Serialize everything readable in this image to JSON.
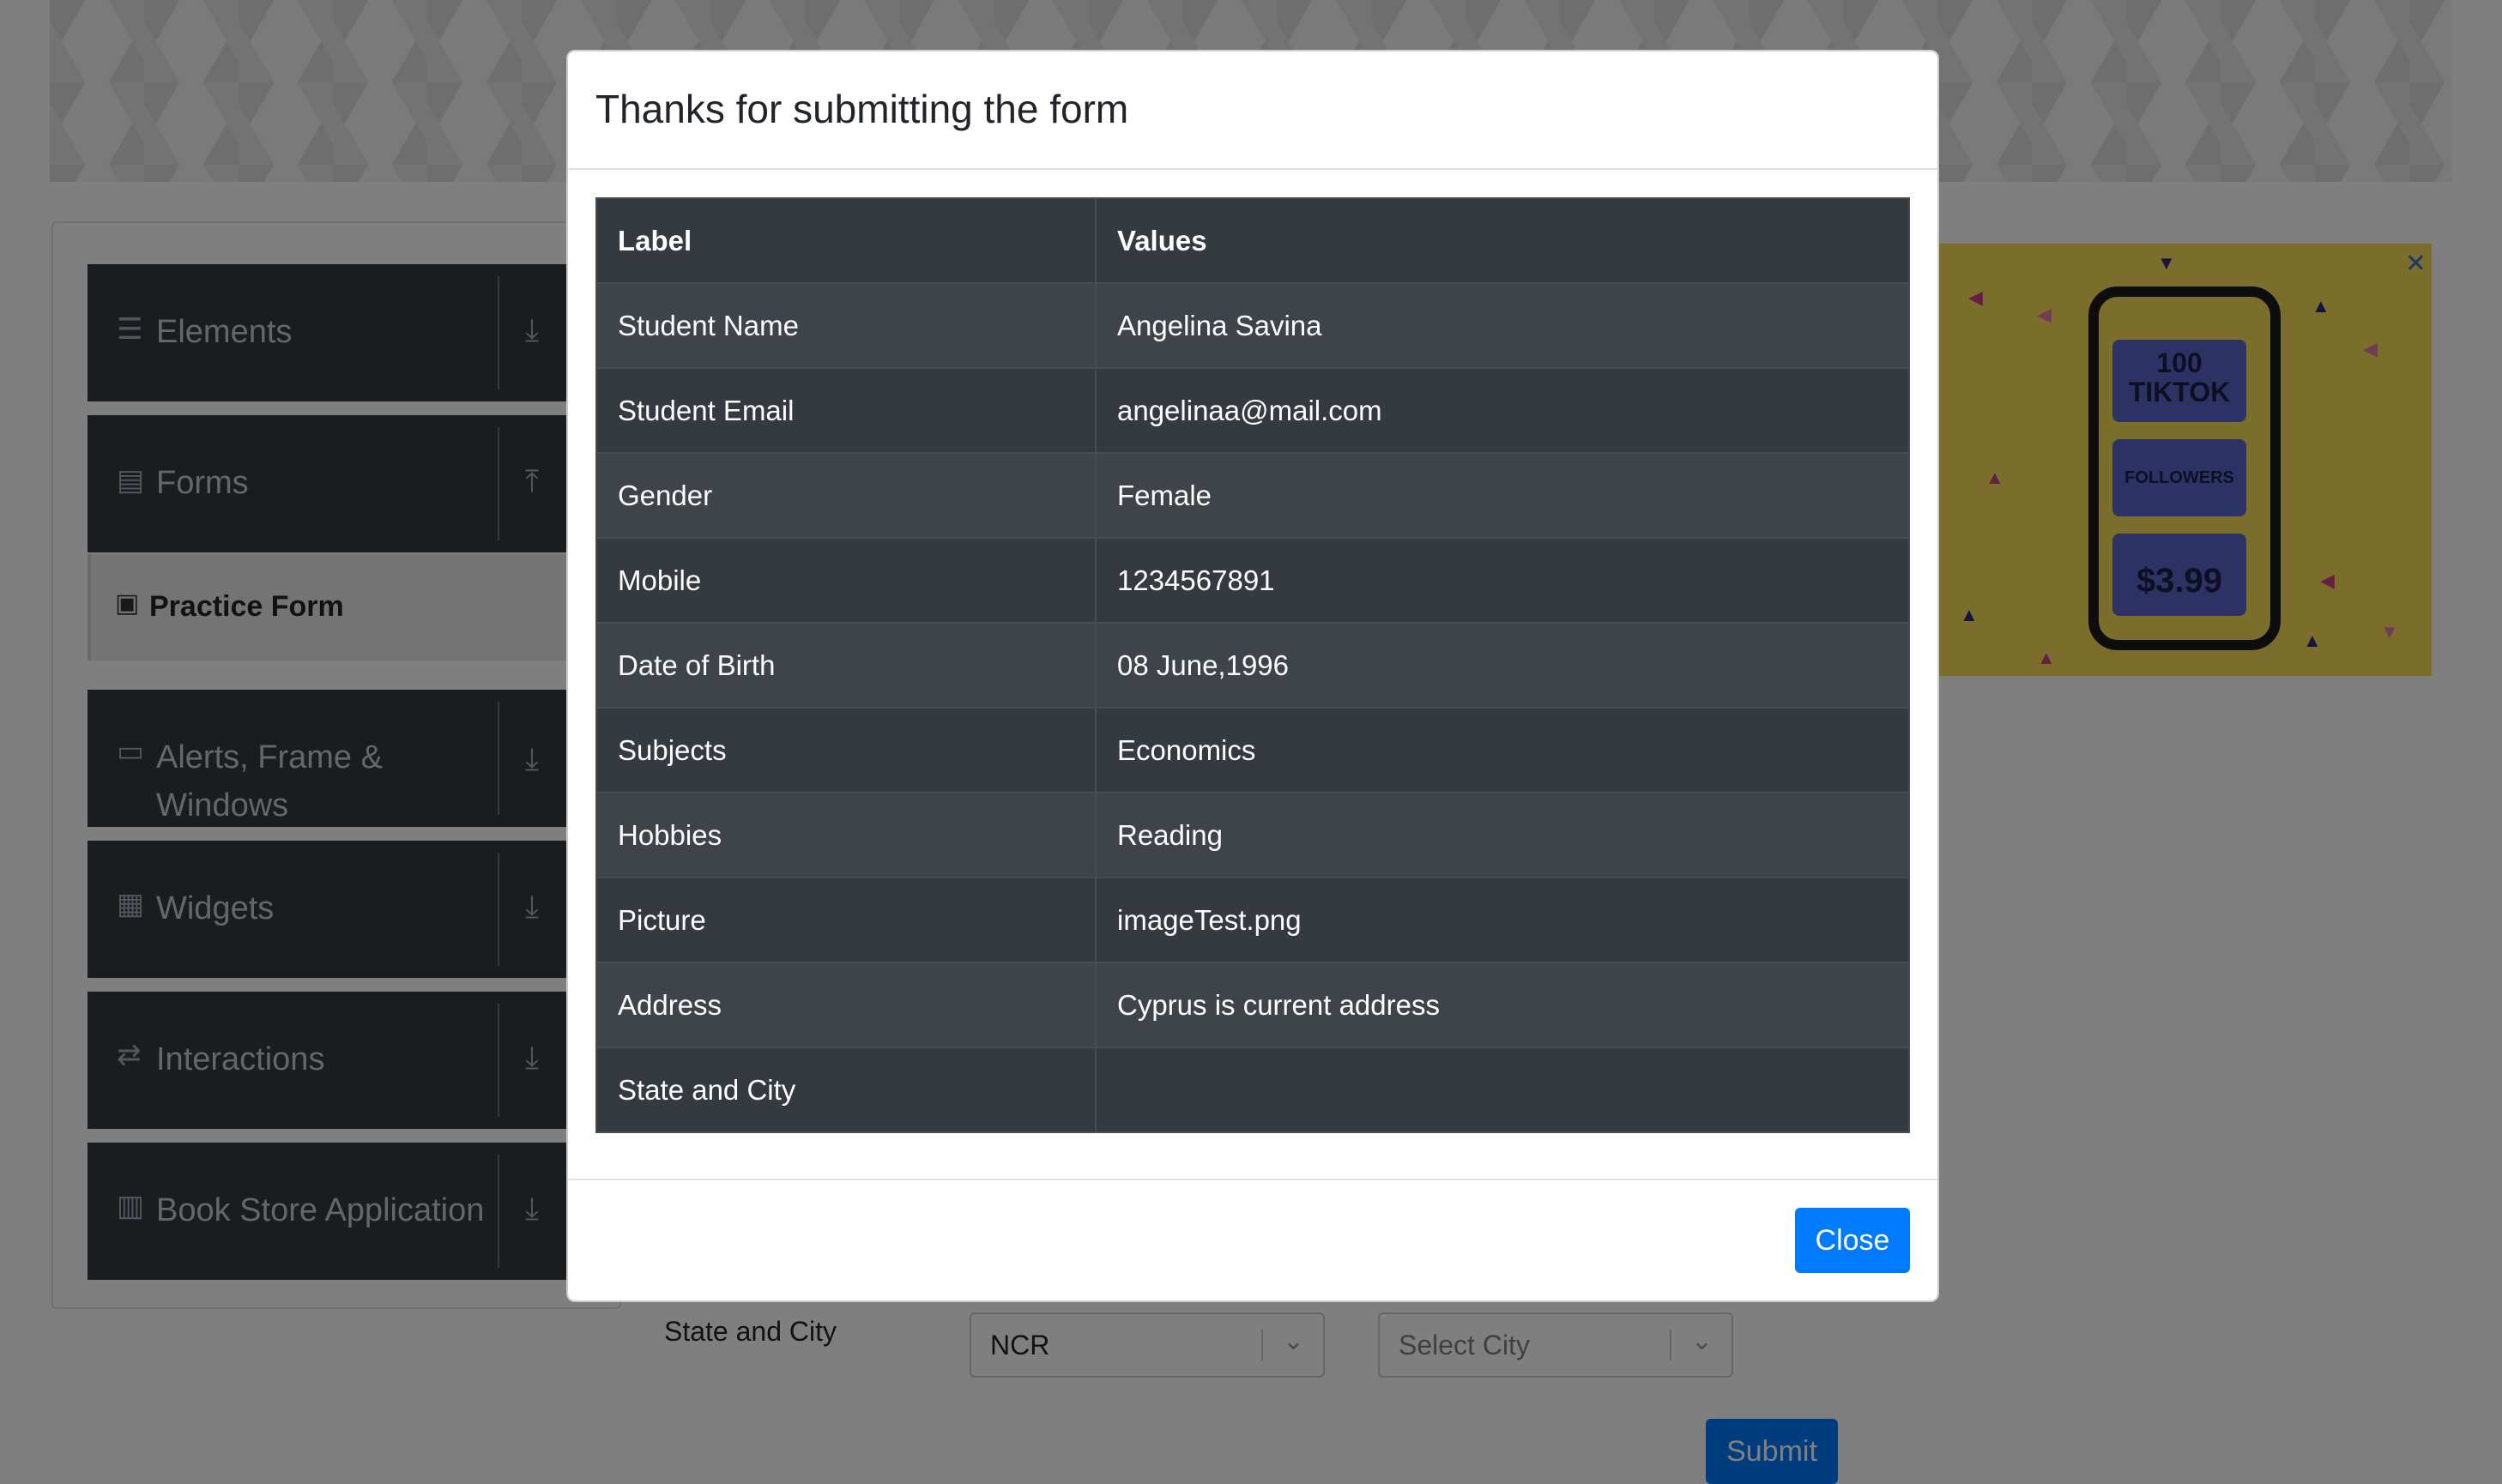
{
  "sidebar": {
    "groups": [
      {
        "label": "Elements",
        "icon": "hamburger-icon",
        "arrow": "download-arrow-icon"
      },
      {
        "label": "Forms",
        "icon": "document-icon",
        "arrow": "upload-arrow-icon"
      },
      {
        "label": "Alerts, Frame &",
        "label2": "Windows",
        "icon": "window-icon",
        "arrow": "download-arrow-icon"
      },
      {
        "label": "Widgets",
        "icon": "grid-icon",
        "arrow": "download-arrow-icon"
      },
      {
        "label": "Interactions",
        "icon": "interaction-icon",
        "arrow": "download-arrow-icon"
      },
      {
        "label": "Book Store Application",
        "icon": "books-icon",
        "arrow": "download-arrow-icon"
      }
    ],
    "active_item": "Practice Form"
  },
  "ad": {
    "line1": "100",
    "line2": "TIKTOK",
    "line3": "FOLLOWERS",
    "price": "$3.99",
    "close": "✕"
  },
  "form": {
    "state_city_label": "State and City",
    "state_value": "NCR",
    "city_placeholder": "Select City",
    "submit_label": "Submit"
  },
  "modal": {
    "title": "Thanks for submitting the form",
    "headers": {
      "label": "Label",
      "values": "Values"
    },
    "rows": [
      {
        "label": "Student Name",
        "value": "Angelina Savina"
      },
      {
        "label": "Student Email",
        "value": "angelinaa@mail.com"
      },
      {
        "label": "Gender",
        "value": "Female"
      },
      {
        "label": "Mobile",
        "value": "1234567891"
      },
      {
        "label": "Date of Birth",
        "value": "08 June,1996"
      },
      {
        "label": "Subjects",
        "value": "Economics"
      },
      {
        "label": "Hobbies",
        "value": "Reading"
      },
      {
        "label": "Picture",
        "value": "imageTest.png"
      },
      {
        "label": "Address",
        "value": "Cyprus is current address"
      },
      {
        "label": "State and City",
        "value": ""
      }
    ],
    "close_label": "Close"
  }
}
